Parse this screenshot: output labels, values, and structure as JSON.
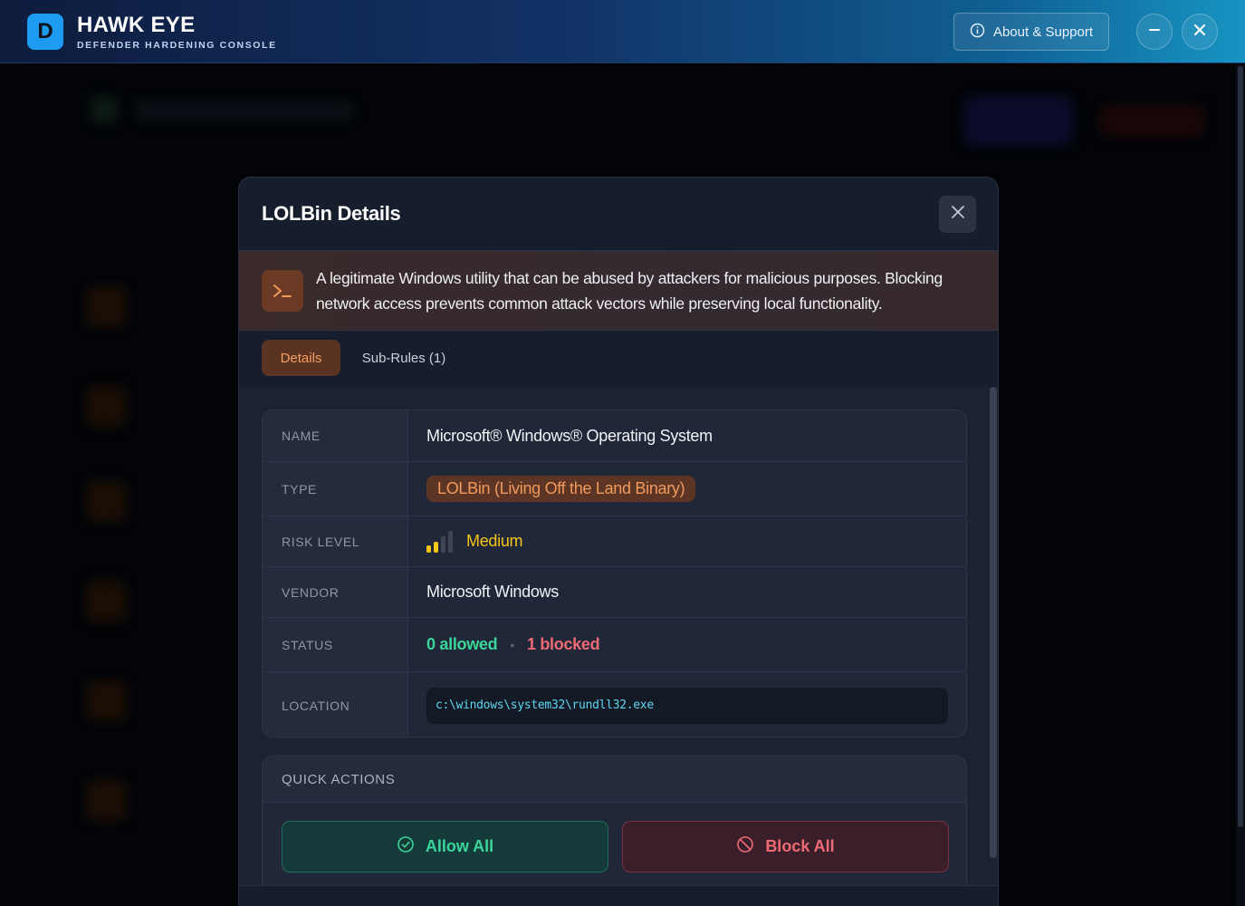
{
  "app": {
    "logo_letter": "D",
    "title": "HAWK EYE",
    "subtitle": "DEFENDER HARDENING CONSOLE",
    "about_label": "About & Support"
  },
  "modal": {
    "title": "LOLBin Details",
    "banner_text": "A legitimate Windows utility that can be abused by attackers for malicious purposes. Blocking network access prevents common attack vectors while preserving local functionality.",
    "tabs": [
      {
        "label": "Details",
        "active": true
      },
      {
        "label": "Sub-Rules (1)",
        "active": false
      }
    ],
    "details": {
      "name_label": "NAME",
      "name_value": "Microsoft® Windows® Operating System",
      "type_label": "TYPE",
      "type_value": "LOLBin (Living Off the Land Binary)",
      "risk_label": "RISK LEVEL",
      "risk_value": "Medium",
      "risk_level": 2,
      "risk_max": 4,
      "vendor_label": "VENDOR",
      "vendor_value": "Microsoft Windows",
      "status_label": "STATUS",
      "status_allowed": "0 allowed",
      "status_separator": "•",
      "status_blocked": "1 blocked",
      "location_label": "LOCATION",
      "location_value": "c:\\windows\\system32\\rundll32.exe"
    },
    "quick_actions": {
      "title": "QUICK ACTIONS",
      "allow_label": "Allow All",
      "block_label": "Block All"
    }
  },
  "colors": {
    "accent_orange": "#f29a5c",
    "allowed_green": "#3bd69a",
    "blocked_red": "#f06a73",
    "risk_yellow": "#f5c518"
  }
}
